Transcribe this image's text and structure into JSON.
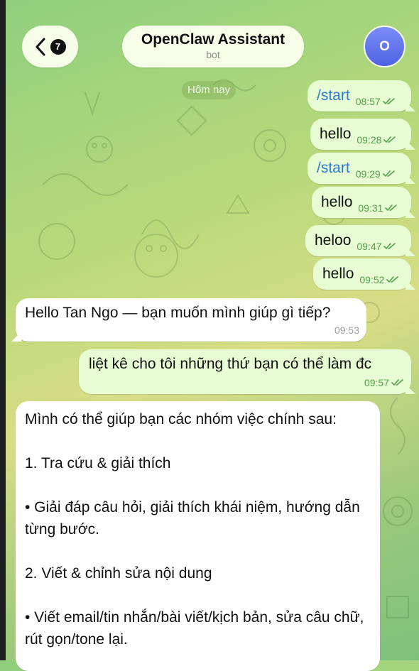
{
  "header": {
    "back_badge": "7",
    "title": "OpenClaw Assistant",
    "subtitle": "bot",
    "avatar_letter": "O"
  },
  "date_separator": "Hôm nay",
  "messages": [
    {
      "text": "/start",
      "time": "08:57",
      "outgoing": true
    },
    {
      "text": "hello",
      "time": "09:28",
      "outgoing": true
    },
    {
      "text": "/start",
      "time": "09:29",
      "outgoing": true
    },
    {
      "text": "hello",
      "time": "09:31",
      "outgoing": true
    },
    {
      "text": "heloo",
      "time": "09:47",
      "outgoing": true
    },
    {
      "text": "hello",
      "time": "09:52",
      "outgoing": true
    },
    {
      "text": "Hello Tan Ngo — bạn muốn mình giúp gì tiếp?",
      "time": "09:53",
      "outgoing": false
    },
    {
      "text": "liệt kê cho tôi những thứ bạn có thể làm đc",
      "time": "09:57",
      "outgoing": true
    }
  ],
  "bot_reply": {
    "lines": [
      "Mình có thể giúp bạn các nhóm việc chính sau:",
      "1. Tra cứu & giải thích",
      "• Giải đáp câu hỏi, giải thích khái niệm, hướng dẫn từng bước.",
      "2. Viết & chỉnh sửa nội dung",
      "• Viết email/tin nhắn/bài viết/kịch bản, sửa câu chữ, rút gọn/tone lại."
    ]
  },
  "colors": {
    "outgoing_bubble": "#e7fcd3",
    "incoming_bubble": "#ffffff",
    "check_marks": "#52a04a",
    "command_link": "#2a7bd6",
    "avatar": "#5b6ff0"
  },
  "icons": {
    "back": "chevron-left-icon",
    "read_status": "double-check-icon"
  }
}
